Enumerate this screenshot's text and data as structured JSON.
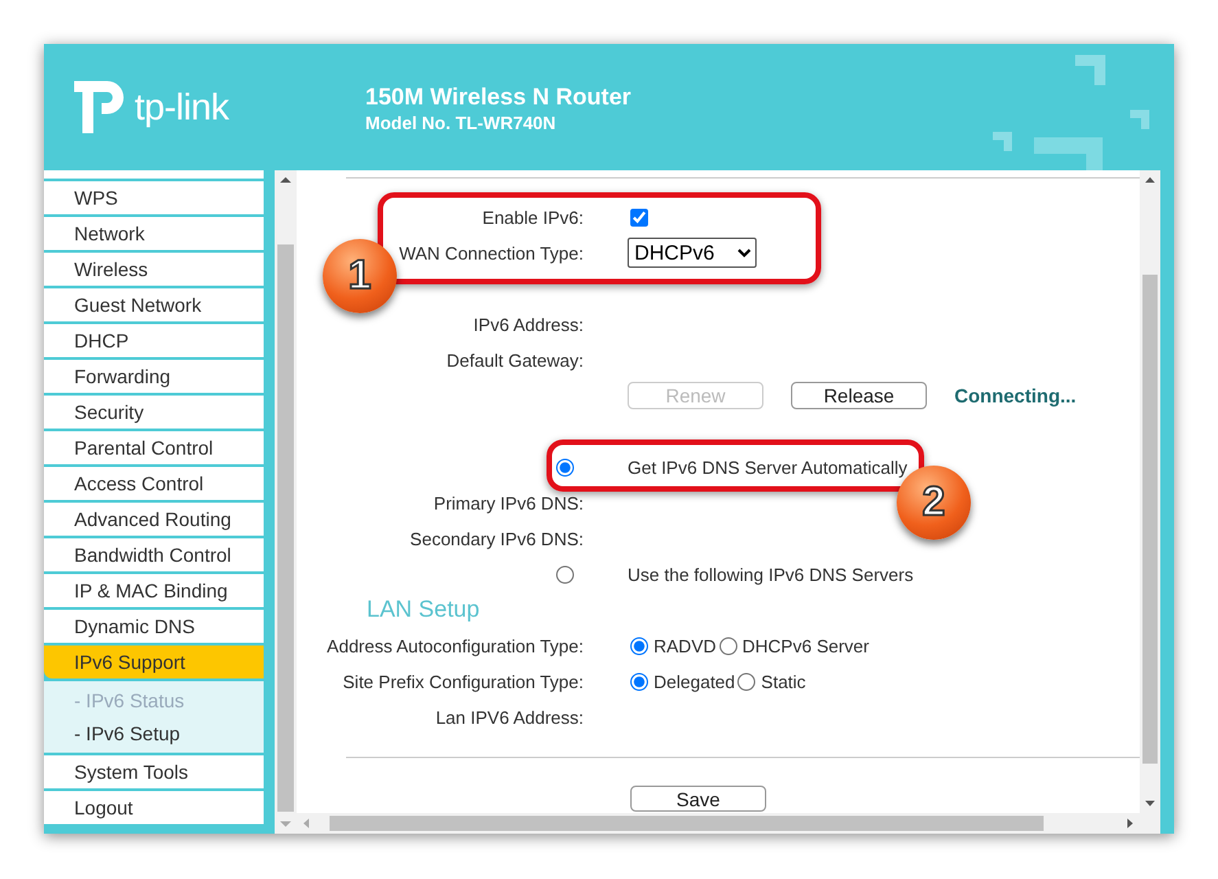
{
  "header": {
    "brand": "tp-link",
    "title": "150M Wireless N Router",
    "model": "Model No. TL-WR740N"
  },
  "sidebar": {
    "items": [
      {
        "label": "WPS",
        "selected": false
      },
      {
        "label": "Network",
        "selected": false
      },
      {
        "label": "Wireless",
        "selected": false
      },
      {
        "label": "Guest Network",
        "selected": false
      },
      {
        "label": "DHCP",
        "selected": false
      },
      {
        "label": "Forwarding",
        "selected": false
      },
      {
        "label": "Security",
        "selected": false
      },
      {
        "label": "Parental Control",
        "selected": false
      },
      {
        "label": "Access Control",
        "selected": false
      },
      {
        "label": "Advanced Routing",
        "selected": false
      },
      {
        "label": "Bandwidth Control",
        "selected": false
      },
      {
        "label": "IP & MAC Binding",
        "selected": false
      },
      {
        "label": "Dynamic DNS",
        "selected": false
      },
      {
        "label": "IPv6 Support",
        "selected": true,
        "children": [
          {
            "label": "- IPv6 Status",
            "selected": false
          },
          {
            "label": "- IPv6 Setup",
            "selected": true
          }
        ]
      },
      {
        "label": "System Tools",
        "selected": false
      },
      {
        "label": "Logout",
        "selected": false
      }
    ]
  },
  "form": {
    "sections": [
      {
        "rows": [
          {
            "kind": "checkbox",
            "label": "Enable IPv6:",
            "checked": true
          },
          {
            "kind": "select",
            "label": "WAN Connection Type:",
            "value": "DHCPv6"
          }
        ]
      },
      {
        "rows": [
          {
            "kind": "text",
            "label": "IPv6 Address:"
          },
          {
            "kind": "text",
            "label": "Default Gateway:"
          },
          {
            "kind": "buttons",
            "buttons": [
              {
                "label": "Renew",
                "disabled": true
              },
              {
                "label": "Release",
                "disabled": false
              }
            ],
            "status": "Connecting..."
          }
        ]
      },
      {
        "rows": [
          {
            "kind": "radio",
            "text": "Get IPv6 DNS Server Automatically",
            "selected": true
          },
          {
            "kind": "text",
            "label": "Primary IPv6 DNS:"
          },
          {
            "kind": "text",
            "label": "Secondary IPv6 DNS:"
          },
          {
            "kind": "radio",
            "text": "Use the following IPv6 DNS Servers",
            "selected": false
          },
          {
            "kind": "heading",
            "text": "LAN Setup"
          },
          {
            "kind": "radios",
            "label": "Address Autoconfiguration Type:",
            "options": [
              {
                "label": "RADVD",
                "selected": true
              },
              {
                "label": "DHCPv6 Server",
                "selected": false
              }
            ]
          },
          {
            "kind": "radios",
            "label": "Site Prefix Configuration Type:",
            "options": [
              {
                "label": "Delegated",
                "selected": true
              },
              {
                "label": "Static",
                "selected": false
              }
            ]
          },
          {
            "kind": "text",
            "label": "Lan IPV6 Address:"
          }
        ]
      }
    ],
    "save_button": "Save"
  },
  "annotations": [
    {
      "number": "1"
    },
    {
      "number": "2"
    }
  ]
}
